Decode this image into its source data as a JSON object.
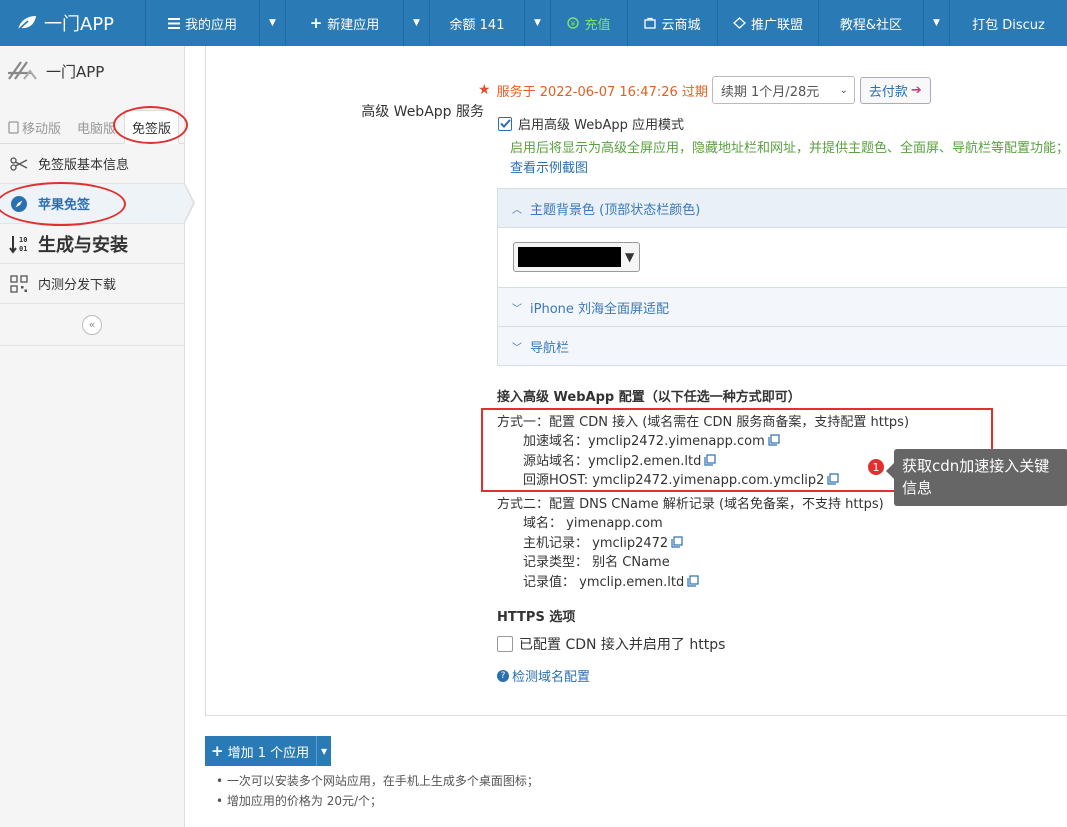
{
  "colors": {
    "nav_bg": "#2a7ab5",
    "accent": "#2a6fb0",
    "warning": "#e06020",
    "hint_green": "#5aa040",
    "annotation_red": "#e03030",
    "theme_color": "#000000"
  },
  "topnav": {
    "brand": "一门APP",
    "items": [
      {
        "label": "我的应用",
        "icon": "list-icon",
        "has_caret": true
      },
      {
        "label": "新建应用",
        "icon": "plus-icon",
        "has_caret": true
      },
      {
        "label": "余额 141",
        "icon": "",
        "has_caret": true
      },
      {
        "label": "充值",
        "icon": "recharge-icon",
        "has_caret": false
      },
      {
        "label": "云商城",
        "icon": "store-icon",
        "has_caret": false
      },
      {
        "label": "推广联盟",
        "icon": "diamond-icon",
        "has_caret": false
      },
      {
        "label": "教程&社区",
        "icon": "",
        "has_caret": true
      },
      {
        "label": "打包 Discuz",
        "icon": "",
        "has_caret": false
      }
    ]
  },
  "sidebar": {
    "app_name": "一门APP",
    "tabs": [
      "移动版",
      "电脑版",
      "免签版"
    ],
    "menu": [
      {
        "label": "免签版基本信息",
        "icon": "scissors-icon"
      },
      {
        "label": "苹果免签",
        "icon": "safari-icon"
      },
      {
        "label": "生成与安装",
        "icon": "sort-icon"
      },
      {
        "label": "内测分发下载",
        "icon": "qrcode-icon"
      }
    ],
    "collapse_glyph": "«"
  },
  "main": {
    "service_label": "高级 WebApp 服务",
    "expiry_text": "服务于 2022-06-07 16:47:26 过期",
    "renew_select": "续期 1个月/28元",
    "pay_button": "去付款",
    "enable_checkbox": "启用高级 WebApp 应用模式",
    "hint": "启用后将显示为高级全屏应用，隐藏地址栏和网址，并提供主题色、全面屏、导航栏等配置功能；",
    "hint_link": "查看示例截图",
    "panels": [
      {
        "title": "主题背景色 (顶部状态栏颜色)",
        "open": true
      },
      {
        "title": "iPhone 刘海全面屏适配",
        "open": false
      },
      {
        "title": "导航栏",
        "open": false
      }
    ],
    "config_title": "接入高级 WebApp 配置（以下任选一种方式即可）",
    "method1": {
      "title": "方式一：配置 CDN 接入 (域名需在 CDN 服务商备案，支持配置 https)",
      "lines": [
        "加速域名：ymclip2472.yimenapp.com",
        "源站域名：ymclip2.emen.ltd",
        "回源HOST: ymclip2472.yimenapp.com.ymclip2"
      ]
    },
    "method2": {
      "title": "方式二：配置 DNS CName 解析记录 (域名免备案，不支持 https)",
      "lines": [
        "域名： yimenapp.com",
        "主机记录： ymclip2472",
        "记录类型： 别名 CName",
        "记录值： ymclip.emen.ltd"
      ],
      "copyable": [
        false,
        true,
        false,
        true
      ]
    },
    "https_title": "HTTPS 选项",
    "https_checkbox": "已配置 CDN 接入并启用了 https",
    "check_link": "检测域名配置",
    "annotation_number": "1",
    "annotation_text": "获取cdn加速接入关键信息"
  },
  "bottom": {
    "add_button": "增加 1 个应用",
    "notes": [
      "• 一次可以安装多个网站应用，在手机上生成多个桌面图标；",
      "• 增加应用的价格为 20元/个；"
    ]
  }
}
